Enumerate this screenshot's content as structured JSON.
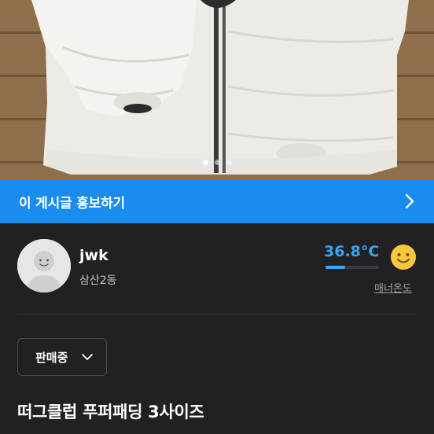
{
  "photo": {
    "description_icon": "product-photo",
    "carousel_dots": 3,
    "active_dot_index": 0
  },
  "promo": {
    "label": "이 게시글 홍보하기",
    "arrow_icon": "chevron-right-icon",
    "color": "#1a8cf0"
  },
  "seller": {
    "nickname": "jwk",
    "region": "삼산2동",
    "manner_temperature": "36.8°C",
    "manner_temperature_value": 36.8,
    "manner_label": "매너온도",
    "temp_color": "#35a6f3",
    "face_icon": "smile-icon"
  },
  "listing": {
    "status_label": "판매중",
    "status_icon": "chevron-down-icon",
    "title": "떠그클럽 푸퍼패딩 3사이즈"
  }
}
